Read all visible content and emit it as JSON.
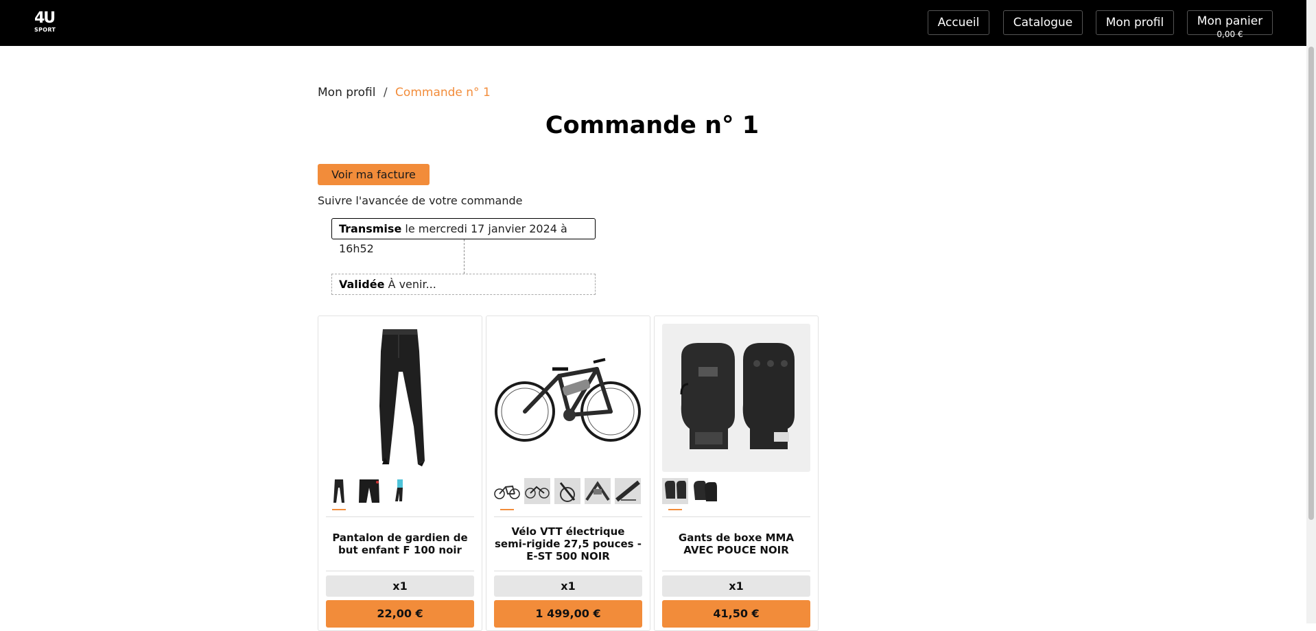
{
  "header": {
    "logo_text": "4U",
    "logo_subtext": "SPORT",
    "nav": {
      "home": "Accueil",
      "catalog": "Catalogue",
      "profile": "Mon profil",
      "cart": "Mon panier",
      "cart_amount": "0,00 €"
    }
  },
  "breadcrumb": {
    "parent": "Mon profil",
    "separator": "/",
    "current": "Commande n° 1"
  },
  "page": {
    "title": "Commande n° 1",
    "invoice_button": "Voir ma facture",
    "follow_text": "Suivre l'avancée de votre commande"
  },
  "tracking": [
    {
      "status": "Transmise",
      "detail": "le mercredi 17 janvier 2024 à 16h52"
    },
    {
      "status": "Validée",
      "detail": "À venir..."
    }
  ],
  "products": [
    {
      "name": "Pantalon de gardien de but enfant F 100 noir",
      "quantity": "x1",
      "price": "22,00 €",
      "image": "black-pants",
      "thumbs": 3
    },
    {
      "name": "Vélo VTT électrique semi-rigide 27,5 pouces - E-ST 500 NOIR",
      "quantity": "x1",
      "price": "1 499,00 €",
      "image": "electric-bike",
      "thumbs": 5
    },
    {
      "name": "Gants de boxe MMA AVEC POUCE NOIR",
      "quantity": "x1",
      "price": "41,50 €",
      "image": "mma-gloves",
      "thumbs": 2
    }
  ],
  "colors": {
    "accent": "#f28c3a",
    "header_bg": "#000000"
  }
}
